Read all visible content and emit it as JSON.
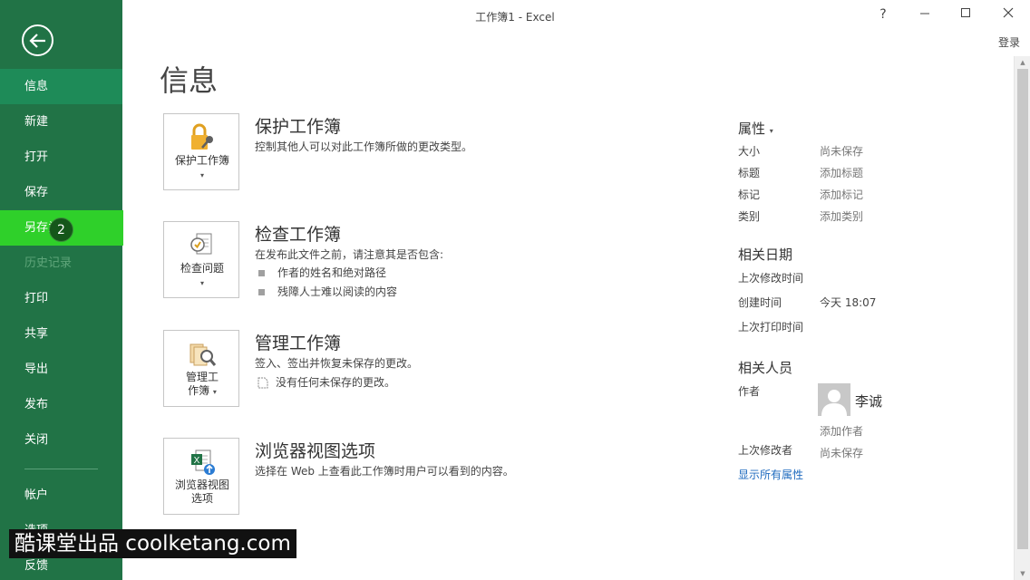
{
  "window": {
    "title": "工作簿1 - Excel",
    "help": "?",
    "signin": "登录"
  },
  "nav": {
    "items": [
      {
        "label": "信息"
      },
      {
        "label": "新建"
      },
      {
        "label": "打开"
      },
      {
        "label": "保存"
      },
      {
        "label": "另存为"
      },
      {
        "label": "历史记录"
      },
      {
        "label": "打印"
      },
      {
        "label": "共享"
      },
      {
        "label": "导出"
      },
      {
        "label": "发布"
      },
      {
        "label": "关闭"
      },
      {
        "label": "帐户"
      },
      {
        "label": "选项"
      },
      {
        "label": "反馈"
      }
    ],
    "step_badge": "2"
  },
  "page": {
    "title": "信息"
  },
  "sections": {
    "protect": {
      "button_label": "保护工作簿",
      "title": "保护工作簿",
      "desc": "控制其他人可以对此工作簿所做的更改类型。"
    },
    "inspect": {
      "button_label": "检查问题",
      "title": "检查工作簿",
      "desc": "在发布此文件之前，请注意其是否包含:",
      "bullets": [
        "作者的姓名和绝对路径",
        "残障人士难以阅读的内容"
      ]
    },
    "manage": {
      "button_line1": "管理工",
      "button_line2": "作簿",
      "title": "管理工作簿",
      "desc": "签入、签出并恢复未保存的更改。",
      "note": "没有任何未保存的更改。"
    },
    "browser": {
      "button_line1": "浏览器视图",
      "button_line2": "选项",
      "title": "浏览器视图选项",
      "desc": "选择在 Web 上查看此工作簿时用户可以看到的内容。"
    }
  },
  "properties": {
    "heading": "属性",
    "rows": [
      {
        "label": "大小",
        "value": "尚未保存"
      },
      {
        "label": "标题",
        "value": "添加标题"
      },
      {
        "label": "标记",
        "value": "添加标记"
      },
      {
        "label": "类别",
        "value": "添加类别"
      }
    ],
    "dates_heading": "相关日期",
    "dates": [
      {
        "label": "上次修改时间",
        "value": ""
      },
      {
        "label": "创建时间",
        "value": "今天 18:07"
      },
      {
        "label": "上次打印时间",
        "value": ""
      }
    ],
    "people_heading": "相关人员",
    "author_label": "作者",
    "author_name": "李诚",
    "add_author": "添加作者",
    "last_modified_by_label": "上次修改者",
    "last_modified_by_value": "尚未保存",
    "show_all": "显示所有属性"
  },
  "watermark": "酷课堂出品 coolketang.com",
  "colors": {
    "nav_bg": "#217346",
    "nav_active": "#1e8b58",
    "nav_highlight": "#2fd02a",
    "link": "#1f6bbf"
  }
}
